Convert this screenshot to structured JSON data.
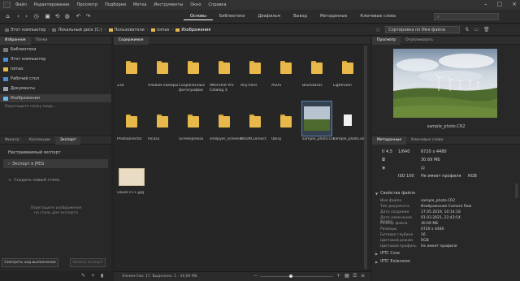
{
  "menubar": {
    "items": [
      "Файл",
      "Редактирование",
      "Просмотр",
      "Подборки",
      "Метка",
      "Инструменты",
      "Окно",
      "Справка"
    ],
    "window_controls": [
      "–",
      "□",
      "×"
    ]
  },
  "workspace": {
    "tabs": [
      "Основы",
      "Библиотеки",
      "Диафильм",
      "Вывод",
      "Метаданные",
      "Ключевые слова"
    ],
    "active": "Основы",
    "search_placeholder": ""
  },
  "path": {
    "crumbs": [
      "Этот компьютер",
      "Локальный диск (C:)",
      "Пользователи",
      "romas",
      "Изображения"
    ],
    "sort_label": "Сортировка по Имя файла"
  },
  "favorites_panel": {
    "tabs": [
      "Избранное",
      "Папки"
    ],
    "items": [
      "Библиотеки",
      "Этот компьютер",
      "romas",
      "Рабочий стол",
      "Документы",
      "Изображения"
    ],
    "selected": "Изображения",
    "drag_tip": "Перетащите папку сюда..."
  },
  "export_panel": {
    "tabs": [
      "Фильтр",
      "Коллекции",
      "Экспорт"
    ],
    "items": [
      "Настраиваемый экспорт",
      "Экспорт в JPEG"
    ],
    "create_style": "Создать новый стиль",
    "drop_hint": "Перетащите изображения на стиль для экспорта",
    "progress_button": "Смотреть ход выполнения",
    "start_button": "Начать экспорт"
  },
  "content": {
    "tab": "Содержимое",
    "items": [
      {
        "label": "234",
        "type": "folder"
      },
      {
        "label": "Альбом камеры",
        "type": "folder"
      },
      {
        "label": "Сохраненные фотографии",
        "type": "folder"
      },
      {
        "label": "AfterShot Pro Catalog 3",
        "type": "folder"
      },
      {
        "label": "AnyTrans",
        "type": "folder"
      },
      {
        "label": "ASUS",
        "type": "folder"
      },
      {
        "label": "BlueStacks",
        "type": "folder"
      },
      {
        "label": "Lightroom",
        "type": "folder"
      },
      {
        "label": "PhotoDirector",
        "type": "folder"
      },
      {
        "label": "Picasa",
        "type": "folder"
      },
      {
        "label": "Screenpresso",
        "type": "folder"
      },
      {
        "label": "smilpyer_screenshots",
        "type": "folder"
      },
      {
        "label": "tdsoftConnect",
        "type": "folder"
      },
      {
        "label": "Ubisy",
        "type": "folder"
      },
      {
        "label": "sample_photo.CR2",
        "type": "image",
        "rating": "☆☆☆☆☆"
      },
      {
        "label": "sample_photo.xmp",
        "type": "doc"
      },
      {
        "label": "visual c++.jpg",
        "type": "jpg"
      }
    ],
    "status": "Элементов: 17, Выделено: 1 - 30,69 МБ"
  },
  "preview": {
    "tabs": [
      "Просмотр",
      "Опубликовать"
    ],
    "caption": "sample_photo.CR2"
  },
  "metadata": {
    "tabs": [
      "Метаданные",
      "Ключевые слова"
    ],
    "summary": {
      "aperture": "f/ 4,5",
      "shutter": "1/640",
      "dims": "6720 x 4480",
      "size": "30.69 МБ",
      "iso": "ISO 100",
      "noprofile": "Не имеет профиля",
      "mode": "RGB"
    },
    "file_props_title": "Свойства файла",
    "props": [
      [
        "Имя файла",
        "sample_photo.CR2"
      ],
      [
        "Тип документа",
        "Изображение Camera Raw"
      ],
      [
        "Дата создания",
        "17.05.2019, 10:14:18"
      ],
      [
        "Дата изменения файла",
        "01.03.2021, 22:43:54"
      ],
      [
        "Размер файла",
        "30.69 МБ"
      ],
      [
        "Размеры",
        "6720 x 4480"
      ],
      [
        "Битовая глубина",
        "16"
      ],
      [
        "Цветовой режим",
        "RGB"
      ],
      [
        "Цветовой профиль",
        "Не имеет профиля"
      ]
    ],
    "sections": [
      "IPTC Core",
      "IPTC Extension"
    ]
  }
}
